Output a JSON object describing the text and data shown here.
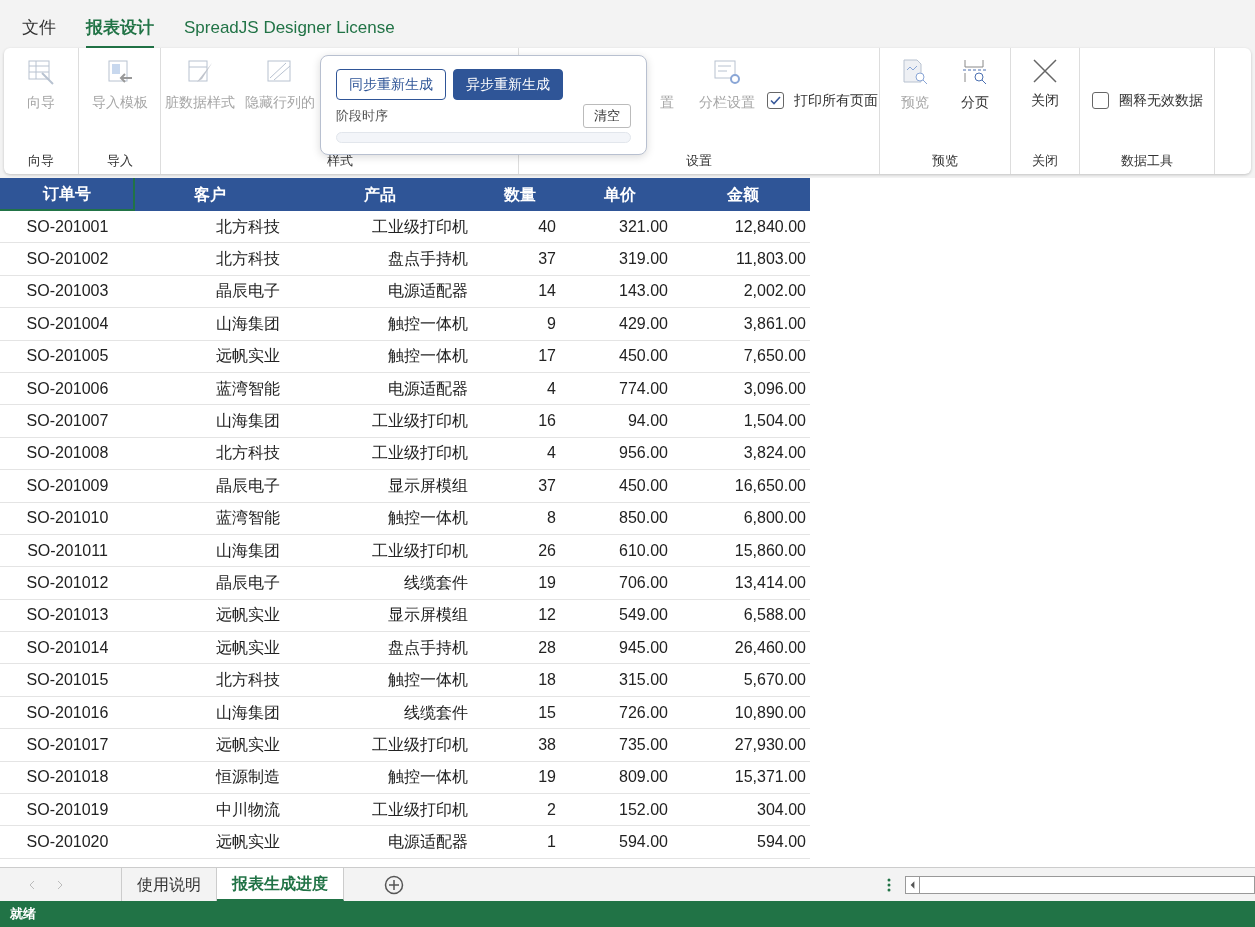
{
  "menu_tabs": [
    {
      "label": "文件",
      "selected": false
    },
    {
      "label": "报表设计",
      "selected": true
    },
    {
      "label": "SpreadJS Designer License",
      "selected": false
    }
  ],
  "ribbon": {
    "groups": [
      {
        "label": "向导",
        "items": [
          {
            "kind": "button",
            "label": "向导",
            "disabled": true
          }
        ]
      },
      {
        "label": "导入",
        "items": [
          {
            "kind": "button",
            "label": "导入模板",
            "disabled": true
          }
        ]
      },
      {
        "label": "样式",
        "items": [
          {
            "kind": "button",
            "label": "脏数据样式",
            "disabled": true
          },
          {
            "kind": "button",
            "label": "隐藏行列的",
            "disabled": true
          }
        ]
      },
      {
        "label": "设置",
        "items": [
          {
            "kind": "button",
            "label": "置",
            "disabled": true
          },
          {
            "kind": "button",
            "label": "分栏设置",
            "disabled": true
          },
          {
            "kind": "checkbox",
            "label": "打印所有页面",
            "checked": true
          }
        ]
      },
      {
        "label": "预览",
        "items": [
          {
            "kind": "button",
            "label": "预览",
            "disabled": true
          },
          {
            "kind": "button",
            "label": "分页",
            "disabled": false
          }
        ]
      },
      {
        "label": "关闭",
        "items": [
          {
            "kind": "button",
            "label": "关闭",
            "disabled": false
          }
        ]
      },
      {
        "label": "数据工具",
        "items": [
          {
            "kind": "checkbox",
            "label": "圈释无效数据",
            "checked": false
          }
        ]
      }
    ]
  },
  "popup": {
    "buttons": [
      {
        "label": "同步重新生成",
        "selected": false
      },
      {
        "label": "异步重新生成",
        "selected": true
      }
    ],
    "stage_label": "阶段时序",
    "clear_button": "清空",
    "progress": {
      "level": 0
    }
  },
  "table": {
    "columns": [
      "订单号",
      "客户",
      "产品",
      "数量",
      "单价",
      "金额"
    ],
    "rows": [
      [
        "SO-201001",
        "北方科技",
        "工业级打印机",
        "40",
        "321.00",
        "12,840.00"
      ],
      [
        "SO-201002",
        "北方科技",
        "盘点手持机",
        "37",
        "319.00",
        "11,803.00"
      ],
      [
        "SO-201003",
        "晶辰电子",
        "电源适配器",
        "14",
        "143.00",
        "2,002.00"
      ],
      [
        "SO-201004",
        "山海集团",
        "触控一体机",
        "9",
        "429.00",
        "3,861.00"
      ],
      [
        "SO-201005",
        "远帆实业",
        "触控一体机",
        "17",
        "450.00",
        "7,650.00"
      ],
      [
        "SO-201006",
        "蓝湾智能",
        "电源适配器",
        "4",
        "774.00",
        "3,096.00"
      ],
      [
        "SO-201007",
        "山海集团",
        "工业级打印机",
        "16",
        "94.00",
        "1,504.00"
      ],
      [
        "SO-201008",
        "北方科技",
        "工业级打印机",
        "4",
        "956.00",
        "3,824.00"
      ],
      [
        "SO-201009",
        "晶辰电子",
        "显示屏模组",
        "37",
        "450.00",
        "16,650.00"
      ],
      [
        "SO-201010",
        "蓝湾智能",
        "触控一体机",
        "8",
        "850.00",
        "6,800.00"
      ],
      [
        "SO-201011",
        "山海集团",
        "工业级打印机",
        "26",
        "610.00",
        "15,860.00"
      ],
      [
        "SO-201012",
        "晶辰电子",
        "线缆套件",
        "19",
        "706.00",
        "13,414.00"
      ],
      [
        "SO-201013",
        "远帆实业",
        "显示屏模组",
        "12",
        "549.00",
        "6,588.00"
      ],
      [
        "SO-201014",
        "远帆实业",
        "盘点手持机",
        "28",
        "945.00",
        "26,460.00"
      ],
      [
        "SO-201015",
        "北方科技",
        "触控一体机",
        "18",
        "315.00",
        "5,670.00"
      ],
      [
        "SO-201016",
        "山海集团",
        "线缆套件",
        "15",
        "726.00",
        "10,890.00"
      ],
      [
        "SO-201017",
        "远帆实业",
        "工业级打印机",
        "38",
        "735.00",
        "27,930.00"
      ],
      [
        "SO-201018",
        "恒源制造",
        "触控一体机",
        "19",
        "809.00",
        "15,371.00"
      ],
      [
        "SO-201019",
        "中川物流",
        "工业级打印机",
        "2",
        "152.00",
        "304.00"
      ],
      [
        "SO-201020",
        "远帆实业",
        "电源适配器",
        "1",
        "594.00",
        "594.00"
      ]
    ]
  },
  "sheet_tabs": [
    {
      "label": "使用说明",
      "selected": false
    },
    {
      "label": "报表生成进度",
      "selected": true
    }
  ],
  "status": "就绪"
}
